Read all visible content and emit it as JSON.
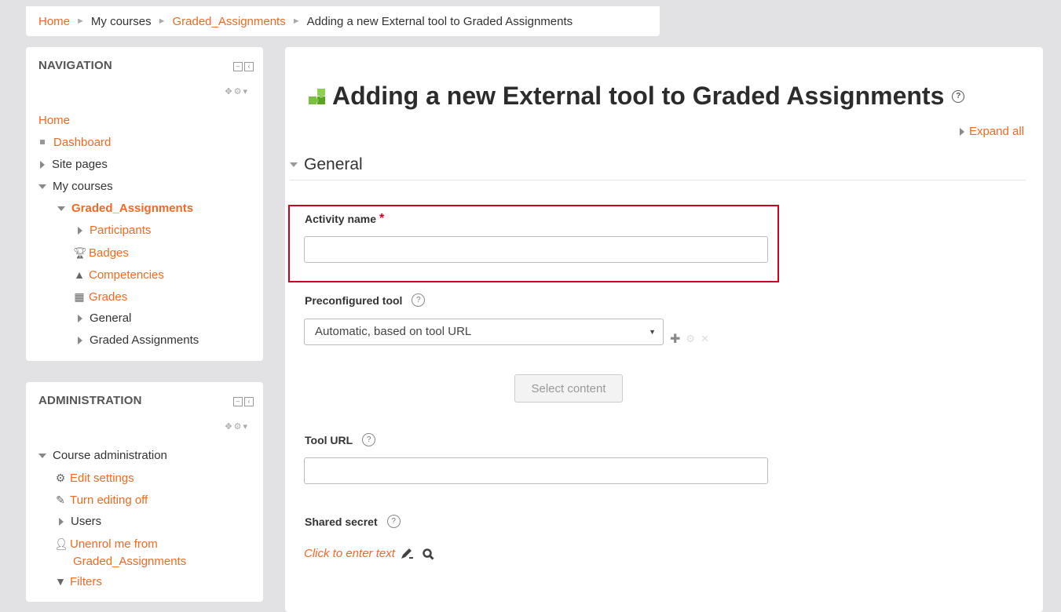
{
  "breadcrumb": {
    "home": "Home",
    "my_courses": "My courses",
    "course": "Graded_Assignments",
    "current": "Adding a new External tool to Graded Assignments",
    "separator": "►"
  },
  "navigation": {
    "title": "NAVIGATION",
    "home": "Home",
    "dashboard": "Dashboard",
    "site_pages": "Site pages",
    "my_courses": "My courses",
    "course": "Graded_Assignments",
    "participants": "Participants",
    "badges": "Badges",
    "competencies": "Competencies",
    "grades": "Grades",
    "general": "General",
    "graded_assignments": "Graded Assignments"
  },
  "administration": {
    "title": "ADMINISTRATION",
    "course_admin": "Course administration",
    "edit_settings": "Edit settings",
    "turn_editing_off": "Turn editing off",
    "users": "Users",
    "unenrol_line1": "Unenrol me from",
    "unenrol_line2": "Graded_Assignments",
    "filters": "Filters"
  },
  "main": {
    "page_title": "Adding a new External tool to Graded Assignments",
    "expand_all": "Expand all",
    "section_general": "General",
    "activity_name_label": "Activity name",
    "required_mark": "*",
    "activity_name_value": "",
    "preconfigured_tool_label": "Preconfigured tool",
    "preconfigured_tool_value": "Automatic, based on tool URL",
    "select_content_button": "Select content",
    "tool_url_label": "Tool URL",
    "tool_url_value": "",
    "shared_secret_label": "Shared secret",
    "shared_secret_placeholder": "Click to enter text"
  },
  "colors": {
    "accent": "#f06a23",
    "highlight_border": "#d0021b",
    "background": "#e2e2e5"
  },
  "icons": [
    "puzzle-icon",
    "help-icon",
    "gear-icon",
    "pencil-icon",
    "search-icon",
    "trophy-icon",
    "grades-icon",
    "user-icon",
    "filter-icon",
    "plus-icon",
    "close-icon"
  ]
}
